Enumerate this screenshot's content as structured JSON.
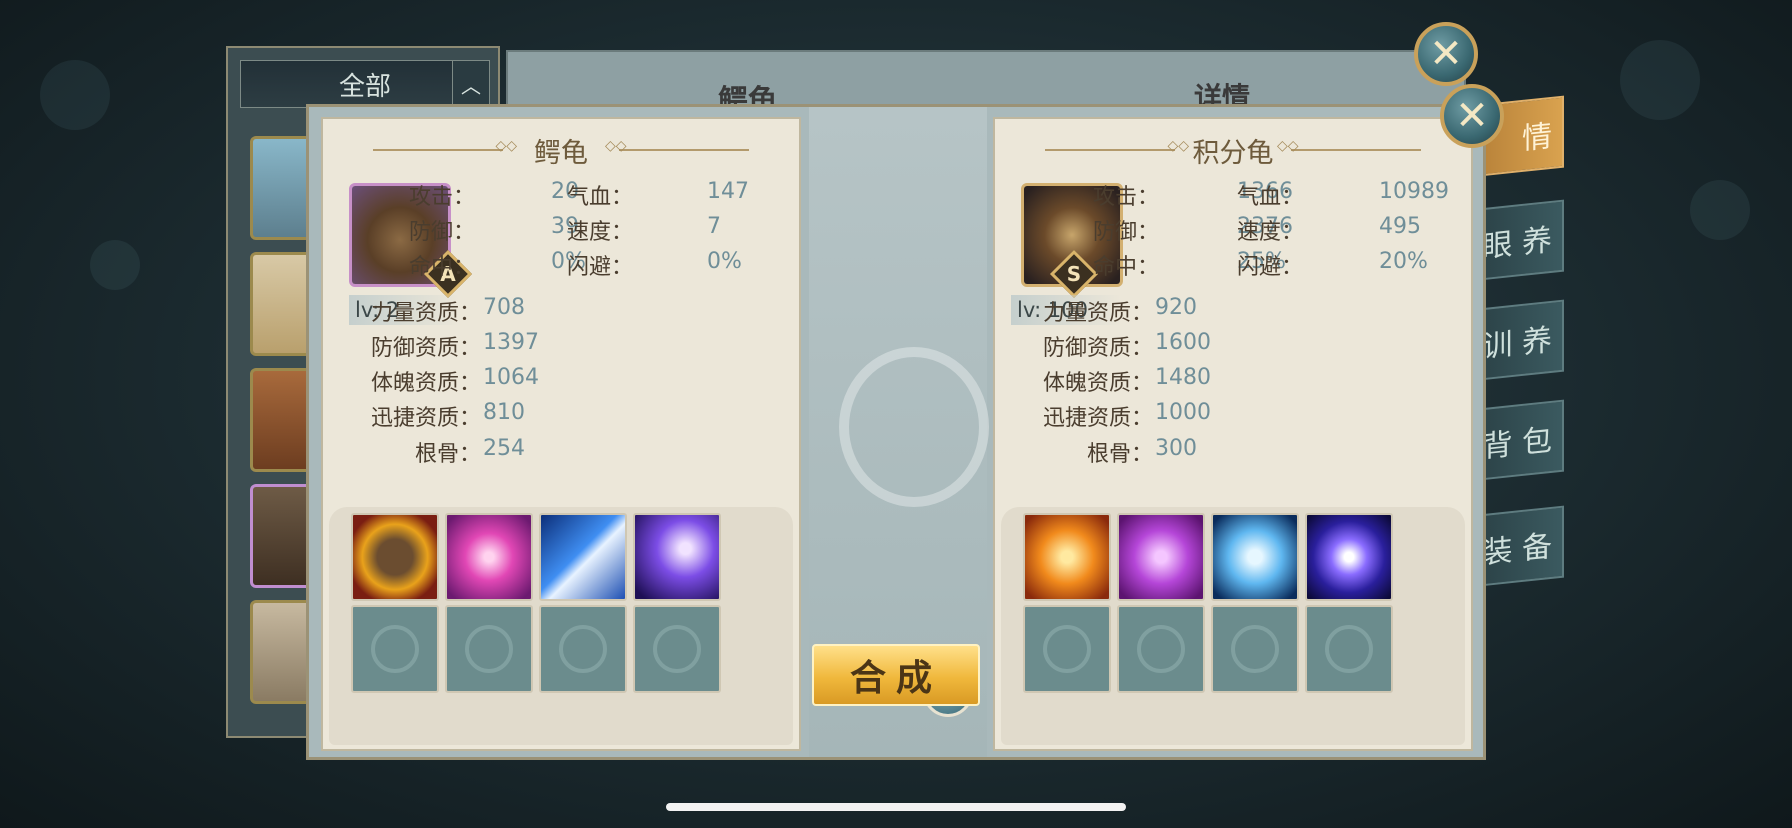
{
  "background_window": {
    "filter_label": "全部",
    "left_title": "鳄龟",
    "right_title": "详情",
    "tabs": [
      "情",
      "眼 养",
      "训 养",
      "背 包",
      "装 备"
    ]
  },
  "left_pet": {
    "name": "鳄龟",
    "grade": "A",
    "level_text": "lv: 2",
    "stats": [
      {
        "label": "攻击：",
        "value": "20"
      },
      {
        "label": "气血：",
        "value": "147"
      },
      {
        "label": "防御：",
        "value": "39"
      },
      {
        "label": "速度：",
        "value": "7"
      },
      {
        "label": "命中：",
        "value": "0%"
      },
      {
        "label": "闪避：",
        "value": "0%"
      }
    ],
    "aptitudes": [
      {
        "label": "力量资质：",
        "value": "708"
      },
      {
        "label": "防御资质：",
        "value": "1397"
      },
      {
        "label": "体魄资质：",
        "value": "1064"
      },
      {
        "label": "迅捷资质：",
        "value": "810"
      },
      {
        "label": "根骨：",
        "value": "254"
      }
    ],
    "skills": [
      "beast-roar-skill-icon",
      "pink-vortex-skill-icon",
      "lightning-arrow-skill-icon",
      "purple-slash-skill-icon"
    ]
  },
  "right_pet": {
    "name": "积分龟",
    "grade": "S",
    "level_text": "lv: 100",
    "stats": [
      {
        "label": "攻击：",
        "value": "1366"
      },
      {
        "label": "气血：",
        "value": "10989"
      },
      {
        "label": "防御：",
        "value": "2376"
      },
      {
        "label": "速度：",
        "value": "495"
      },
      {
        "label": "命中：",
        "value": "25%"
      },
      {
        "label": "闪避：",
        "value": "20%"
      }
    ],
    "aptitudes": [
      {
        "label": "力量资质：",
        "value": "920"
      },
      {
        "label": "防御资质：",
        "value": "1600"
      },
      {
        "label": "体魄资质：",
        "value": "1480"
      },
      {
        "label": "迅捷资质：",
        "value": "1000"
      },
      {
        "label": "根骨：",
        "value": "300"
      }
    ],
    "skills": [
      "fire-shield-skill-icon",
      "purple-shield-skill-icon",
      "blue-heart-skill-icon",
      "energy-orb-skill-icon"
    ]
  },
  "help_label": "?",
  "compose_label": "合成",
  "colors": {
    "panel": "#ece7d9",
    "accent_gold": "#f0b83c",
    "stat_value": "#6f8e98"
  }
}
